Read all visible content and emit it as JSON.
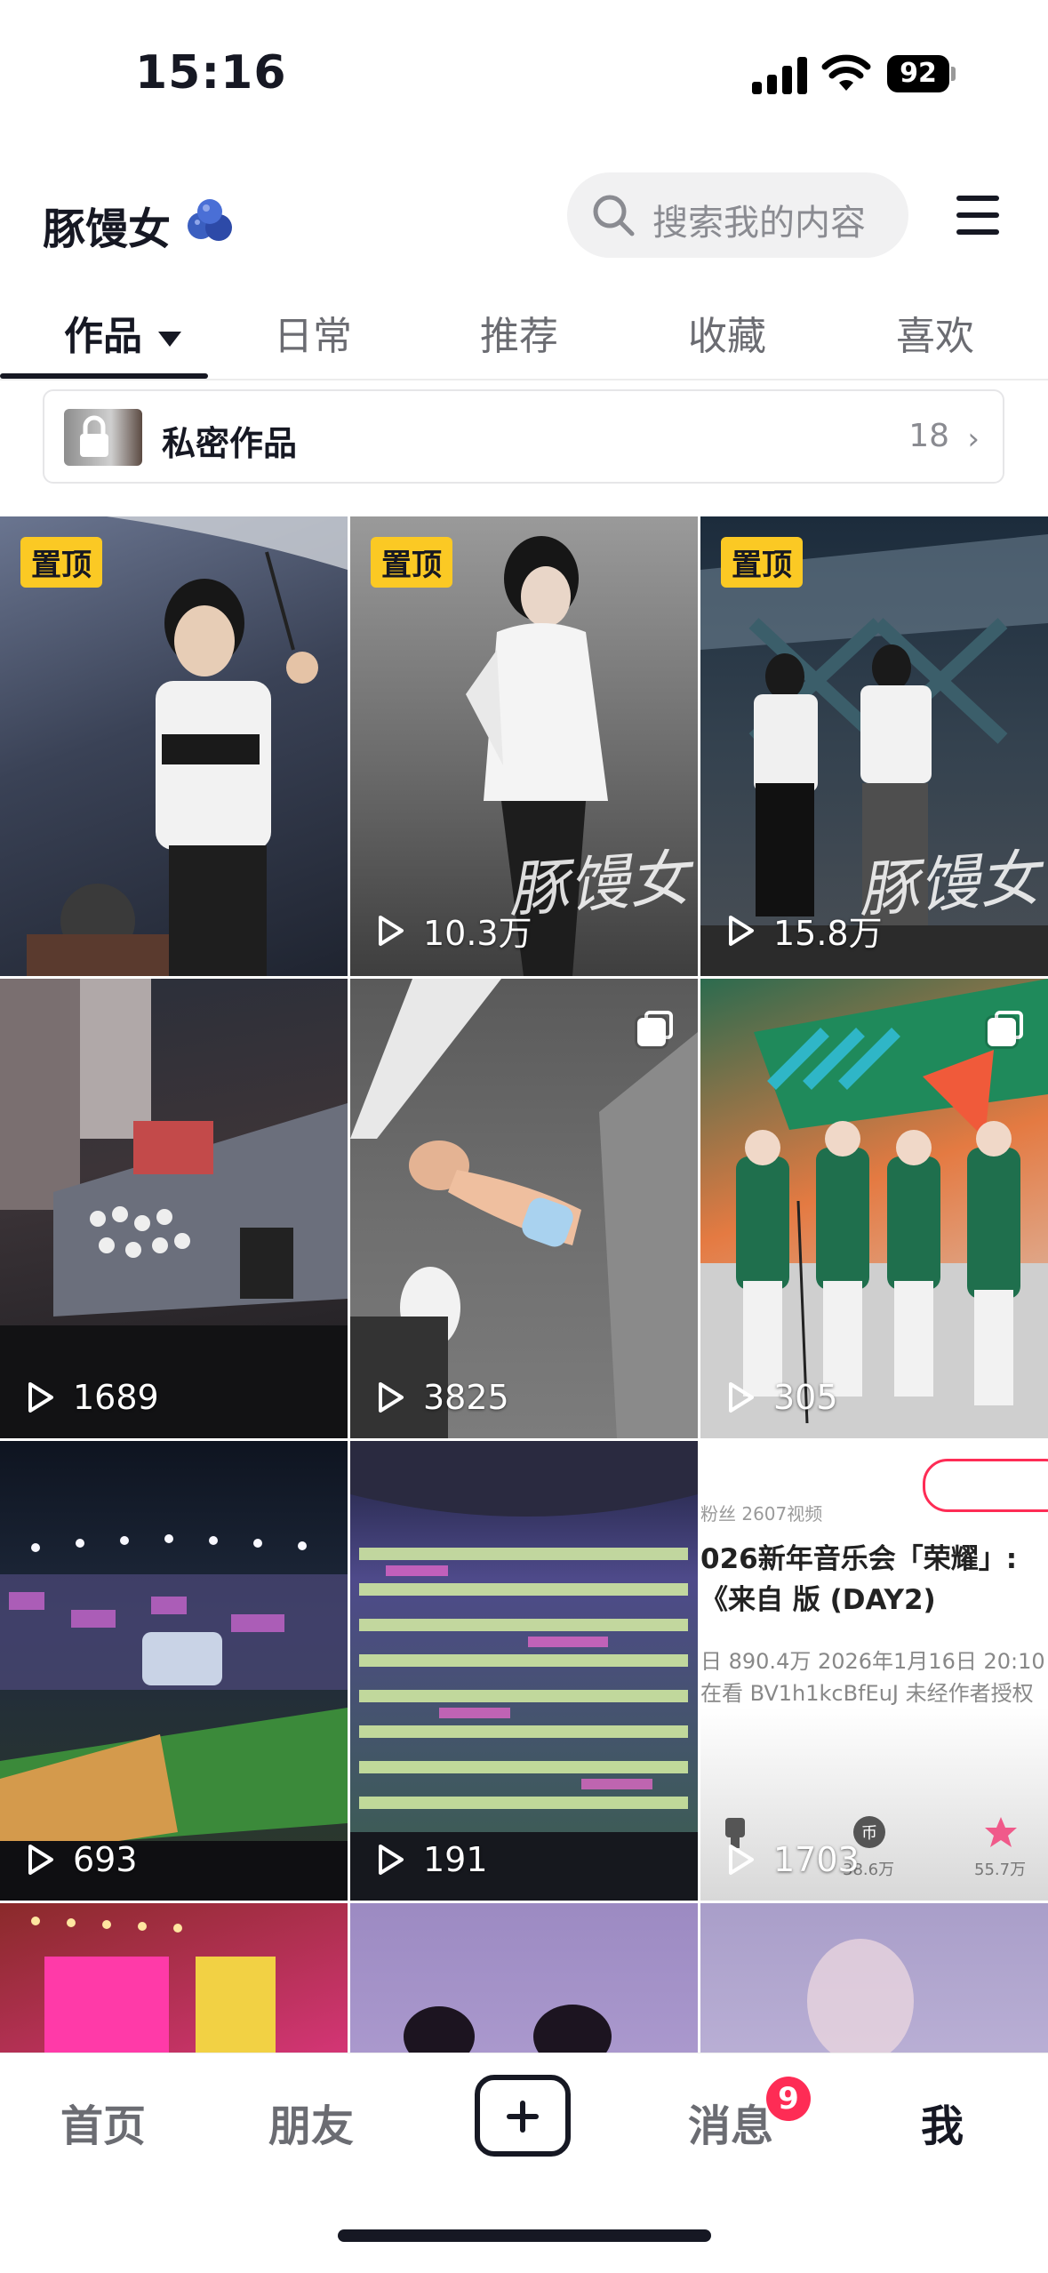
{
  "status_bar": {
    "time": "15:16",
    "battery": "92"
  },
  "header": {
    "username": "豚馒女",
    "search_placeholder": "搜索我的内容"
  },
  "tabs": [
    {
      "label": "作品",
      "active": true
    },
    {
      "label": "日常"
    },
    {
      "label": "推荐"
    },
    {
      "label": "收藏"
    },
    {
      "label": "喜欢"
    }
  ],
  "private_works": {
    "label": "私密作品",
    "count": "18"
  },
  "grid": [
    {
      "pinned": "置顶",
      "plays": ""
    },
    {
      "pinned": "置顶",
      "plays": "10.3万",
      "watermark": "豚馒女"
    },
    {
      "pinned": "置顶",
      "plays": "15.8万",
      "watermark": "豚馒女"
    },
    {
      "plays": "1689"
    },
    {
      "plays": "3825",
      "multi": true
    },
    {
      "plays": "305",
      "multi": true
    },
    {
      "plays": "693"
    },
    {
      "plays": "191"
    },
    {
      "plays": "1703",
      "screenshot": {
        "meta": "粉丝  2607视频",
        "title": "026新年音乐会「荣耀」:《来自 版 (DAY2)",
        "info_line1": "日 890.4万  2026年1月16日 20:10",
        "info_line2": "在看  BV1h1kcBfEuJ  未经作者授权",
        "icon_label_1": "38.6万",
        "icon_label_2": "55.7万"
      }
    }
  ],
  "bottom_nav": {
    "home": "首页",
    "friends": "朋友",
    "messages": "消息",
    "messages_badge": "9",
    "me": "我"
  },
  "colors": {
    "accent": "#fe2c55",
    "pin": "#fbc924",
    "text": "#161823"
  }
}
